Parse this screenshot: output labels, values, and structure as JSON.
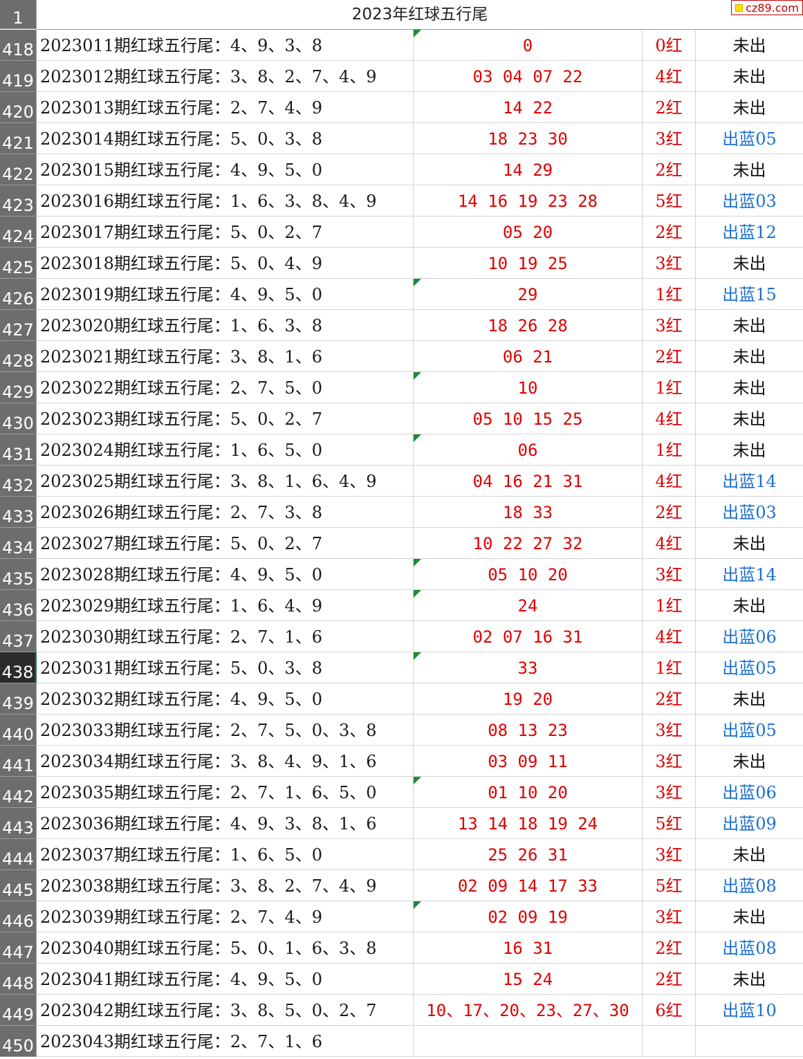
{
  "header": {
    "row_number": "1",
    "title": "2023年红球五行尾",
    "logo_text": "cz89.com"
  },
  "rows": [
    {
      "num": "418",
      "desc": "2023011期红球五行尾：4、9、3、8",
      "nums": "0",
      "count": "0红",
      "blue": "未出",
      "flag": true
    },
    {
      "num": "419",
      "desc": "2023012期红球五行尾：3、8、2、7、4、9",
      "nums": "03 04 07 22",
      "count": "4红",
      "blue": "未出",
      "flag": false
    },
    {
      "num": "420",
      "desc": "2023013期红球五行尾：2、7、4、9",
      "nums": "14 22",
      "count": "2红",
      "blue": "未出",
      "flag": false
    },
    {
      "num": "421",
      "desc": "2023014期红球五行尾：5、0、3、8",
      "nums": "18 23 30",
      "count": "3红",
      "blue": "出蓝05",
      "flag": false
    },
    {
      "num": "422",
      "desc": "2023015期红球五行尾：4、9、5、0",
      "nums": "14 29",
      "count": "2红",
      "blue": "未出",
      "flag": false
    },
    {
      "num": "423",
      "desc": "2023016期红球五行尾：1、6、3、8、4、9",
      "nums": "14 16 19 23 28",
      "count": "5红",
      "blue": "出蓝03",
      "flag": false
    },
    {
      "num": "424",
      "desc": "2023017期红球五行尾：5、0、2、7",
      "nums": "05 20",
      "count": "2红",
      "blue": "出蓝12",
      "flag": false
    },
    {
      "num": "425",
      "desc": "2023018期红球五行尾：5、0、4、9",
      "nums": "10 19 25",
      "count": "3红",
      "blue": "未出",
      "flag": false
    },
    {
      "num": "426",
      "desc": "2023019期红球五行尾：4、9、5、0",
      "nums": "29",
      "count": "1红",
      "blue": "出蓝15",
      "flag": true
    },
    {
      "num": "427",
      "desc": "2023020期红球五行尾：1、6、3、8",
      "nums": "18 26 28",
      "count": "3红",
      "blue": "未出",
      "flag": false
    },
    {
      "num": "428",
      "desc": "2023021期红球五行尾：3、8、1、6",
      "nums": "06 21",
      "count": "2红",
      "blue": "未出",
      "flag": false
    },
    {
      "num": "429",
      "desc": "2023022期红球五行尾：2、7、5、0",
      "nums": "10",
      "count": "1红",
      "blue": "未出",
      "flag": true
    },
    {
      "num": "430",
      "desc": "2023023期红球五行尾：5、0、2、7",
      "nums": "05 10 15 25",
      "count": "4红",
      "blue": "未出",
      "flag": false
    },
    {
      "num": "431",
      "desc": "2023024期红球五行尾：1、6、5、0",
      "nums": "06",
      "count": "1红",
      "blue": "未出",
      "flag": true
    },
    {
      "num": "432",
      "desc": "2023025期红球五行尾：3、8、1、6、4、9",
      "nums": "04 16 21 31",
      "count": "4红",
      "blue": "出蓝14",
      "flag": false
    },
    {
      "num": "433",
      "desc": "2023026期红球五行尾：2、7、3、8",
      "nums": "18 33",
      "count": "2红",
      "blue": "出蓝03",
      "flag": false
    },
    {
      "num": "434",
      "desc": "2023027期红球五行尾：5、0、2、7",
      "nums": "10 22 27 32",
      "count": "4红",
      "blue": "未出",
      "flag": false
    },
    {
      "num": "435",
      "desc": "2023028期红球五行尾：4、9、5、0",
      "nums": "05 10 20",
      "count": "3红",
      "blue": "出蓝14",
      "flag": true
    },
    {
      "num": "436",
      "desc": "2023029期红球五行尾：1、6、4、9",
      "nums": "24",
      "count": "1红",
      "blue": "未出",
      "flag": true
    },
    {
      "num": "437",
      "desc": "2023030期红球五行尾：2、7、1、6",
      "nums": "02 07 16 31",
      "count": "4红",
      "blue": "出蓝06",
      "flag": false
    },
    {
      "num": "438",
      "desc": "2023031期红球五行尾：5、0、3、8",
      "nums": "33",
      "count": "1红",
      "blue": "出蓝05",
      "flag": true,
      "active": true
    },
    {
      "num": "439",
      "desc": "2023032期红球五行尾：4、9、5、0",
      "nums": "19 20",
      "count": "2红",
      "blue": "未出",
      "flag": false
    },
    {
      "num": "440",
      "desc": "2023033期红球五行尾：2、7、5、0、3、8",
      "nums": "08 13 23",
      "count": "3红",
      "blue": "出蓝05",
      "flag": false
    },
    {
      "num": "441",
      "desc": "2023034期红球五行尾：3、8、4、9、1、6",
      "nums": "03 09 11",
      "count": "3红",
      "blue": "未出",
      "flag": false
    },
    {
      "num": "442",
      "desc": "2023035期红球五行尾：2、7、1、6、5、0",
      "nums": "01 10 20",
      "count": "3红",
      "blue": "出蓝06",
      "flag": true
    },
    {
      "num": "443",
      "desc": "2023036期红球五行尾：4、9、3、8、1、6",
      "nums": "13 14 18 19 24",
      "count": "5红",
      "blue": "出蓝09",
      "flag": false
    },
    {
      "num": "444",
      "desc": "2023037期红球五行尾：1、6、5、0",
      "nums": "25 26 31",
      "count": "3红",
      "blue": "未出",
      "flag": false
    },
    {
      "num": "445",
      "desc": "2023038期红球五行尾：3、8、2、7、4、9",
      "nums": "02 09 14 17 33",
      "count": "5红",
      "blue": "出蓝08",
      "flag": false
    },
    {
      "num": "446",
      "desc": "2023039期红球五行尾：2、7、4、9",
      "nums": "02 09 19",
      "count": "3红",
      "blue": "未出",
      "flag": true
    },
    {
      "num": "447",
      "desc": "2023040期红球五行尾：5、0、1、6、3、8",
      "nums": "16 31",
      "count": "2红",
      "blue": "出蓝08",
      "flag": false
    },
    {
      "num": "448",
      "desc": "2023041期红球五行尾：4、9、5、0",
      "nums": "15 24",
      "count": "2红",
      "blue": "未出",
      "flag": false
    },
    {
      "num": "449",
      "desc": "2023042期红球五行尾：3、8、5、0、2、7",
      "nums": "10、17、20、23、27、30",
      "count": "6红",
      "blue": "出蓝10",
      "flag": false
    },
    {
      "num": "450",
      "desc": "2023043期红球五行尾：2、7、1、6",
      "nums": "",
      "count": "",
      "blue": "",
      "flag": false
    }
  ]
}
